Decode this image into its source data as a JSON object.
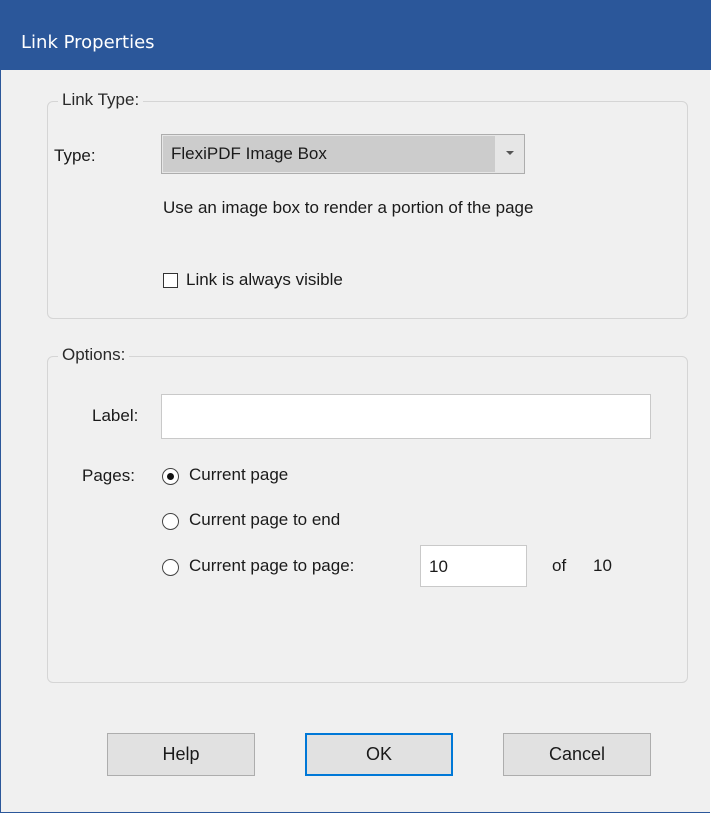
{
  "window": {
    "title": "Link Properties"
  },
  "link_type_group": {
    "legend": "Link Type:",
    "type_label": "Type:",
    "type_selected": "FlexiPDF Image Box",
    "description": "Use an image box to render a portion of the page",
    "always_visible_label": "Link is always visible",
    "always_visible_checked": false
  },
  "options_group": {
    "legend": "Options:",
    "label_label": "Label:",
    "label_value": "",
    "pages_label": "Pages:",
    "page_options": [
      {
        "label": "Current page",
        "checked": true
      },
      {
        "label": "Current page to end",
        "checked": false
      },
      {
        "label": "Current page to page:",
        "checked": false
      }
    ],
    "to_page_value": "10",
    "of_label": "of",
    "total_pages": "10"
  },
  "buttons": {
    "help": "Help",
    "ok": "OK",
    "cancel": "Cancel"
  }
}
